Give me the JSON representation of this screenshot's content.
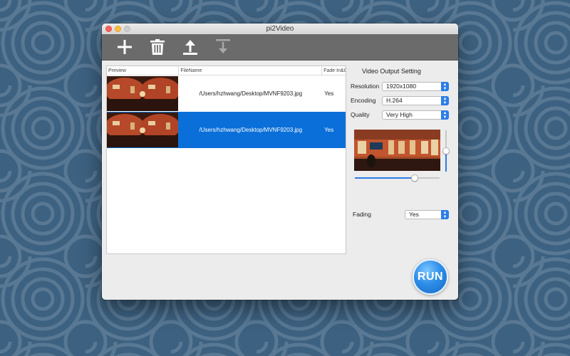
{
  "window": {
    "title": "pi2Video"
  },
  "toolbar": {
    "buttons": [
      {
        "icon": "add-icon",
        "label": ""
      },
      {
        "icon": "trash-icon",
        "label": ""
      },
      {
        "icon": "export-icon",
        "label": ""
      },
      {
        "icon": "import-icon",
        "label": "",
        "disabled": true
      }
    ]
  },
  "table": {
    "columns": [
      "Preview",
      "FileName",
      "Fade In&O"
    ],
    "rows": [
      {
        "filename": "/Users/hzhwang/Desktop/MVNF9203.jpg",
        "fade": "Yes",
        "selected": false
      },
      {
        "filename": "/Users/hzhwang/Desktop/MVNF9203.jpg",
        "fade": "Yes",
        "selected": true
      }
    ]
  },
  "settings": {
    "title": "Video Output Setting",
    "resolution_label": "Resolution",
    "resolution_value": "1920x1080",
    "encoding_label": "Encoding",
    "encoding_value": "H.264",
    "quality_label": "Quality",
    "quality_value": "Very High",
    "fading_label": "Fading",
    "fading_value": "Yes",
    "vertical_slider_level": 0.5,
    "horizontal_slider_level": 0.71
  },
  "run_label": "RUN",
  "colors": {
    "accent": "#0a6fd8",
    "toolbar": "#6b6b6b",
    "desktop": "#3f6482"
  }
}
